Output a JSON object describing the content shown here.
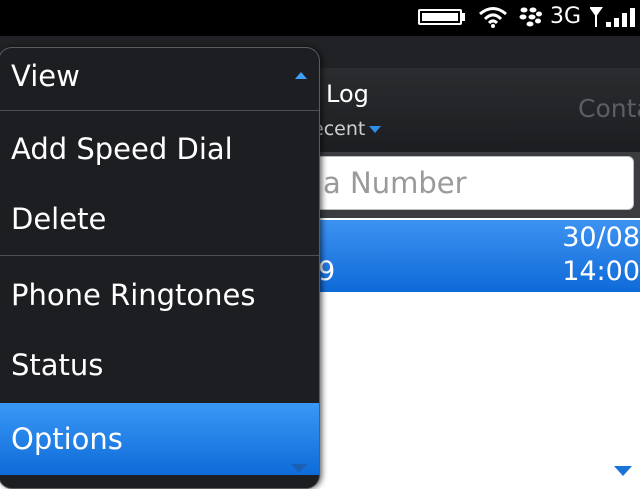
{
  "status_bar": {
    "network_type": "3G",
    "icons": [
      "battery-icon",
      "wifi-icon",
      "blackberry-logo-icon",
      "signal-strength-icon"
    ]
  },
  "header": {
    "tab_title": "Log",
    "filter_label": "ecent",
    "other_tab": "Conta"
  },
  "search": {
    "placeholder": "al a Number"
  },
  "log_entry": {
    "date": "30/08",
    "time": "14:00",
    "number_fragment": "9"
  },
  "menu": {
    "items": [
      {
        "label": "View"
      },
      {
        "label": "Add Speed Dial"
      },
      {
        "label": "Delete"
      },
      {
        "label": "Phone Ringtones"
      },
      {
        "label": "Status"
      },
      {
        "label": "Options",
        "selected": true
      }
    ]
  },
  "colors": {
    "accent": "#0e6bd8",
    "menu_bg": "#1d1e21",
    "status_bg": "#000000"
  }
}
